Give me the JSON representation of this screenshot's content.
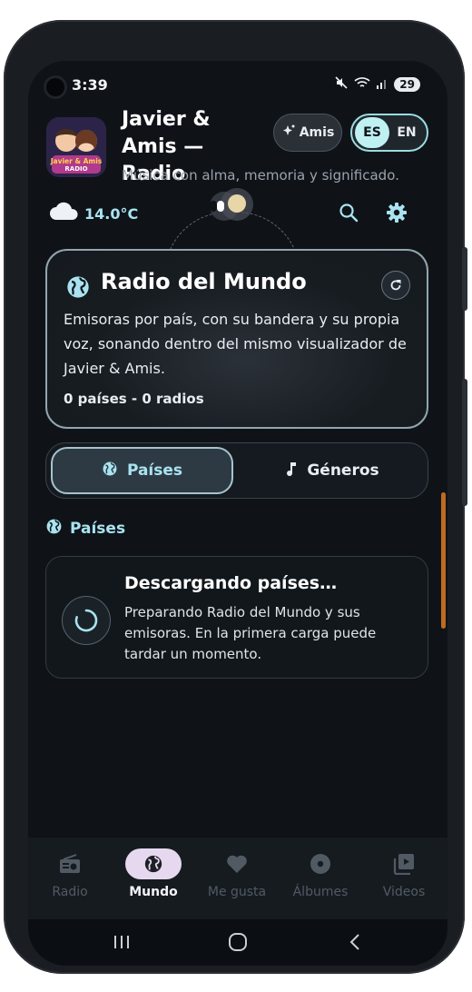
{
  "status_bar": {
    "time": "3:39",
    "battery": "29"
  },
  "header": {
    "title": "Javier & Amis — Radio",
    "tagline": "Música con alma, memoria y significado.",
    "logo_text_1": "Javier & Amis",
    "logo_text_2": "RADIO",
    "amis_button": "Amis",
    "languages": [
      "ES",
      "EN"
    ],
    "active_language": "ES"
  },
  "weather": {
    "temperature": "14.0°C",
    "icon": "cloud-icon"
  },
  "hero": {
    "title": "Radio del Mundo",
    "description": "Emisoras por país, con su bandera y su propia voz, sonando dentro del mismo visualizador de Javier & Amis.",
    "counts": "0 países - 0 radios"
  },
  "tabs": [
    {
      "label": "Países",
      "icon": "globe-icon",
      "active": true
    },
    {
      "label": "Géneros",
      "icon": "music-note-icon",
      "active": false
    }
  ],
  "section": {
    "title": "Países"
  },
  "loading": {
    "title": "Descargando países…",
    "description": "Preparando Radio del Mundo y sus emisoras. En la primera carga puede tardar un momento."
  },
  "bottom_nav": [
    {
      "label": "Radio",
      "icon": "radio-icon",
      "active": false
    },
    {
      "label": "Mundo",
      "icon": "globe-icon",
      "active": true
    },
    {
      "label": "Me gusta",
      "icon": "heart-icon",
      "active": false
    },
    {
      "label": "Álbumes",
      "icon": "disc-icon",
      "active": false
    },
    {
      "label": "Videos",
      "icon": "video-library-icon",
      "active": false
    }
  ],
  "colors": {
    "accent": "#a9e3f0",
    "background": "#0f1318",
    "nav_active_pill": "#e6d9ef",
    "scroll_indicator": "#c06a22"
  }
}
